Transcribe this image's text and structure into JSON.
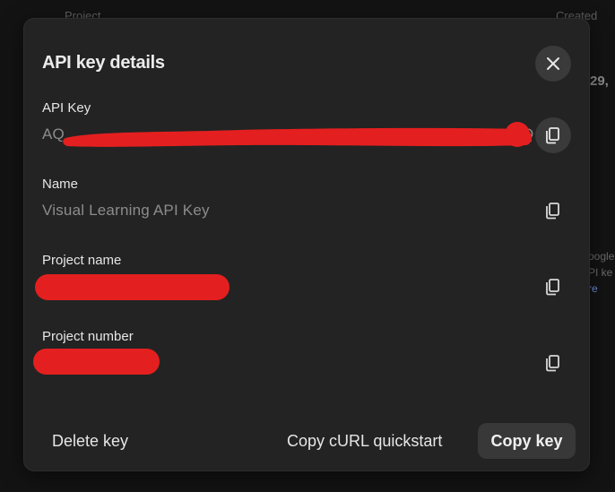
{
  "background": {
    "header_left": "Project",
    "header_right": "Created",
    "row_date_fragment": "29,",
    "side_note": [
      "oogle",
      "PI ke",
      "re"
    ]
  },
  "modal": {
    "title": "API key details",
    "close_icon": "close-icon",
    "fields": [
      {
        "label": "API Key",
        "value": "AQ",
        "value_tail": "Q",
        "redacted": true
      },
      {
        "label": "Name",
        "value": "Visual Learning API Key",
        "redacted": false
      },
      {
        "label": "Project name",
        "value": "",
        "redacted": true
      },
      {
        "label": "Project number",
        "value": "",
        "redacted": true
      }
    ],
    "copy_icon": "copy-icon",
    "footer": {
      "delete_label": "Delete key",
      "curl_label": "Copy cURL quickstart",
      "copy_key_label": "Copy key"
    }
  },
  "colors": {
    "modal_bg": "#232323",
    "page_bg": "#131313",
    "redaction": "#e41f1f",
    "button_bg": "#383838"
  }
}
